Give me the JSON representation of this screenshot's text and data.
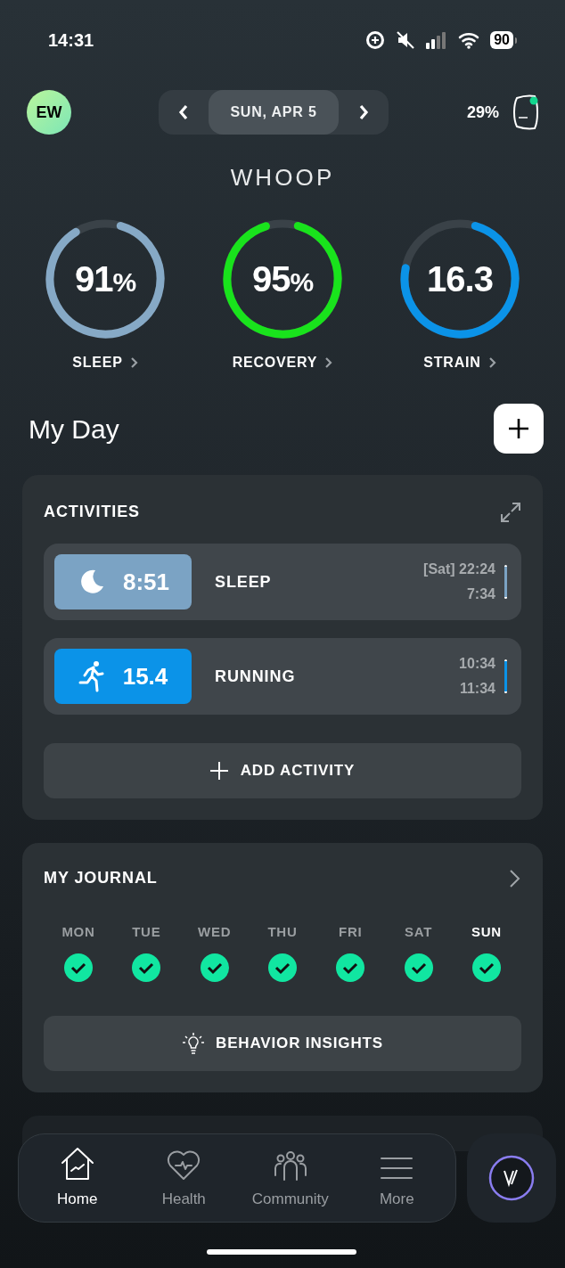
{
  "status_bar": {
    "time": "14:31",
    "battery": "90"
  },
  "header": {
    "avatar": "EW",
    "date": "SUN, APR 5",
    "device_battery": "29%",
    "logo": "WHOOP"
  },
  "rings": [
    {
      "value": "91",
      "unit": "%",
      "label": "SLEEP",
      "color": "#86a9c6"
    },
    {
      "value": "95",
      "unit": "%",
      "label": "RECOVERY",
      "color": "#19e31c"
    },
    {
      "value": "16.3",
      "label": "STRAIN",
      "color": "#0b93e8"
    }
  ],
  "my_day": {
    "title": "My Day"
  },
  "activities": {
    "title": "ACTIVITIES",
    "items": [
      {
        "kind": "sleep",
        "value": "8:51",
        "name": "SLEEP",
        "start": "[Sat] 22:24",
        "end": "7:34",
        "color": "#7ba3c4"
      },
      {
        "kind": "running",
        "value": "15.4",
        "name": "RUNNING",
        "start": "10:34",
        "end": "11:34",
        "color": "#0b93e8"
      }
    ],
    "add_button": "ADD ACTIVITY"
  },
  "journal": {
    "title": "MY JOURNAL",
    "days": [
      {
        "label": "MON",
        "checked": true,
        "selected": false
      },
      {
        "label": "TUE",
        "checked": true,
        "selected": false
      },
      {
        "label": "WED",
        "checked": true,
        "selected": false
      },
      {
        "label": "THU",
        "checked": true,
        "selected": false
      },
      {
        "label": "FRI",
        "checked": true,
        "selected": false
      },
      {
        "label": "SAT",
        "checked": true,
        "selected": false
      },
      {
        "label": "SUN",
        "checked": true,
        "selected": true
      }
    ],
    "insights_button": "BEHAVIOR INSIGHTS"
  },
  "tab_bar": [
    {
      "kind": "home",
      "label": "Home",
      "selected": true
    },
    {
      "kind": "health",
      "label": "Health",
      "selected": false
    },
    {
      "kind": "community",
      "label": "Community",
      "selected": false
    },
    {
      "kind": "more",
      "label": "More",
      "selected": false
    }
  ]
}
